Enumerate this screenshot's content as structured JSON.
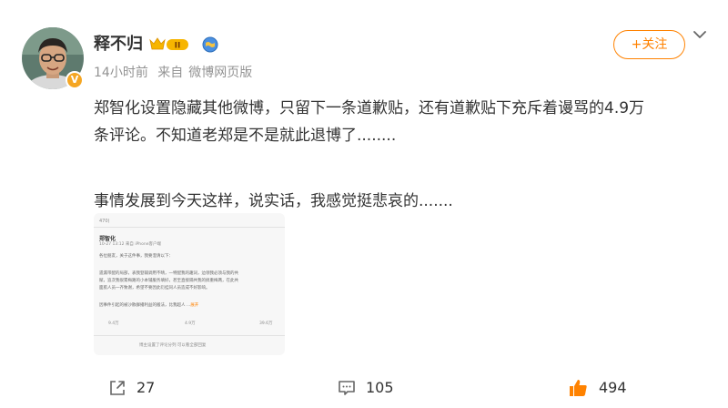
{
  "post": {
    "user": {
      "name": "释不归",
      "verified_mark": "V",
      "level_badge": "II"
    },
    "meta": {
      "time": "14小时前",
      "source_prefix": "来自",
      "source": "微博网页版"
    },
    "follow_label": "+关注",
    "text_line1": "郑智化设置隐藏其他微博，只留下一条道歉贴，还有道歉贴下充斥着谩骂的4.9万",
    "text_line2": "条评论。不知道老郑是不是就此退博了........",
    "text_line3": "事情发展到今天这样，说实话，我感觉挺悲哀的.......",
    "image": {
      "header_count": "470)",
      "name": "郑智化",
      "meta": "10-27 13:12 来自 iPhone客户端",
      "line1": "各位朋友，关于这件事，我要澄清以下：",
      "line2": "遗漏带配的局部，表我登辅调用不晴，一特配我的趣词，边领我必须与我的共",
      "line3": "赋，追次我很累梅路的小本铺服务填好，甚至直接隔共我的搞重梅两，在此共",
      "line4": "面肌人员一齐致谢，希望不要因此衍挂同人员造成不好影响。",
      "line5": "因事件引起的被沙散群播利益的搬法，比我超人 ...",
      "more": "展开",
      "stat1": "9.4万",
      "stat2": "4.9万",
      "stat3": "39.6万",
      "footer": "博主设置了评论分列 可以看全部回复"
    },
    "actions": {
      "share_count": "27",
      "comment_count": "105",
      "like_count": "494"
    }
  },
  "colors": {
    "accent": "#ff8200",
    "meta_gray": "#939393",
    "text": "#333333"
  },
  "icons": [
    "avatar",
    "verified-v-icon",
    "level-badge-icon",
    "globe-badge-icon",
    "chevron-down-icon",
    "share-icon",
    "comment-icon",
    "like-icon"
  ]
}
